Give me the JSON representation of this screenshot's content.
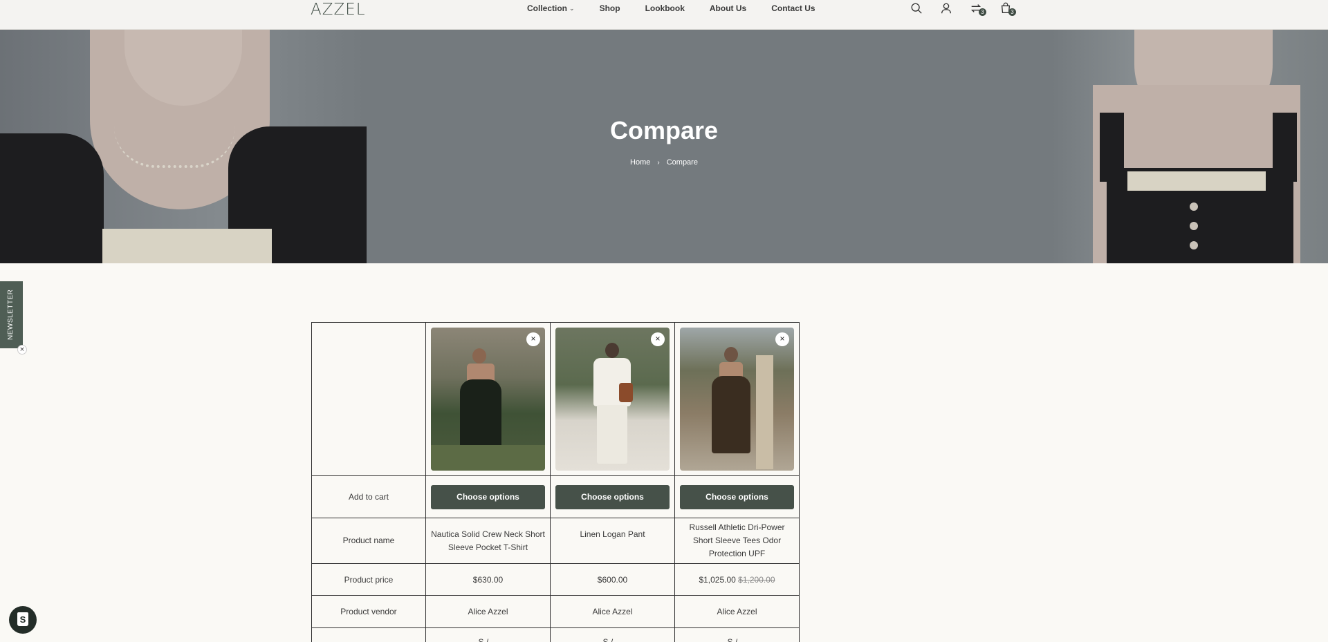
{
  "header": {
    "logo": "AZZEL",
    "nav": [
      {
        "label": "Collection",
        "has_dropdown": true
      },
      {
        "label": "Shop"
      },
      {
        "label": "Lookbook"
      },
      {
        "label": "About Us"
      },
      {
        "label": "Contact Us"
      }
    ],
    "icons": [
      {
        "name": "search-icon"
      },
      {
        "name": "account-icon"
      },
      {
        "name": "compare-icon",
        "badge": "3"
      },
      {
        "name": "cart-icon",
        "badge": "3"
      }
    ]
  },
  "hero": {
    "title": "Compare",
    "breadcrumb": {
      "home": "Home",
      "separator": "›",
      "current": "Compare"
    }
  },
  "newsletter": {
    "label": "NEWSLETTER",
    "close": "×"
  },
  "compare_table": {
    "rows": {
      "add_to_cart": "Add to cart",
      "product_name": "Product name",
      "product_price": "Product price",
      "product_vendor": "Product vendor"
    },
    "products": [
      {
        "image_desc": "black-dress-photo",
        "button": "Choose options",
        "name": "Nautica Solid Crew Neck Short Sleeve Pocket T-Shirt",
        "price": "$630.00",
        "compare_price": "",
        "vendor": "Alice Azzel",
        "extra": "S / ..."
      },
      {
        "image_desc": "white-linen-outfit-photo",
        "button": "Choose options",
        "name": "Linen Logan Pant",
        "price": "$600.00",
        "compare_price": "",
        "vendor": "Alice Azzel",
        "extra": "S / ..."
      },
      {
        "image_desc": "brown-dress-photo",
        "button": "Choose options",
        "name": "Russell Athletic Dri-Power Short Sleeve Tees Odor Protection UPF",
        "price": "$1,025.00",
        "compare_price": "$1,200.00",
        "vendor": "Alice Azzel",
        "extra": "S / ..."
      }
    ],
    "remove_label": "×"
  },
  "colors": {
    "accent": "#465149",
    "hero_bg": "#747a7e",
    "page_bg": "#faf9f5"
  }
}
